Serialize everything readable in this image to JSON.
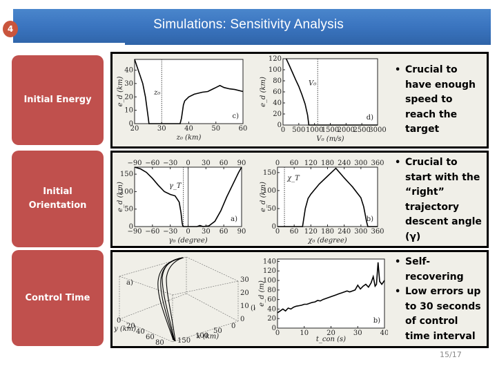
{
  "slide": {
    "section_number": "4",
    "title": "Simulations: Sensitivity Analysis",
    "page": "15/17",
    "colors": {
      "header": "#3a74bf",
      "label_box": "#c0504d",
      "badge": "#c9553d",
      "panel_bg": "#f0efe8"
    }
  },
  "rows": [
    {
      "label": "Initial Energy",
      "bullets": [
        "Crucial to have enough speed to reach the target"
      ]
    },
    {
      "label": "Initial Orientation",
      "bullets": [
        "Crucial to start with the “right” trajectory descent angle (γ)"
      ]
    },
    {
      "label": "Control Time",
      "bullets": [
        "Self-recovering",
        "Low errors up to 30 seconds of control time interval"
      ]
    }
  ],
  "chart_data": [
    {
      "type": "line",
      "panel": "c)",
      "xlabel": "z₀ (km)",
      "ylabel": "e_d (km)",
      "xlim": [
        20,
        60
      ],
      "ylim": [
        0,
        48
      ],
      "xticks": [
        20,
        30,
        40,
        50,
        60
      ],
      "yticks": [
        0,
        10,
        20,
        30,
        40
      ],
      "marker_label": "z₀",
      "marker_x": 30,
      "x": [
        20,
        21,
        22,
        23,
        24,
        25,
        25.3,
        30,
        36,
        36.8,
        37.3,
        38,
        38.5,
        40,
        42,
        45,
        47,
        49,
        50,
        51.5,
        53,
        55,
        57,
        60
      ],
      "y": [
        48,
        42,
        36,
        30,
        20,
        5,
        0,
        0,
        0,
        0,
        4,
        14,
        17,
        20,
        22,
        23.5,
        24,
        26,
        27,
        28.5,
        27,
        26,
        25.5,
        24
      ]
    },
    {
      "type": "line",
      "panel": "d)",
      "xlabel": "V₀ (m/s)",
      "ylabel": "e_d (km)",
      "xlim": [
        0,
        3000
      ],
      "ylim": [
        0,
        120
      ],
      "xticks": [
        0,
        500,
        1000,
        1500,
        2000,
        2500,
        3000
      ],
      "yticks": [
        0,
        20,
        40,
        60,
        80,
        100,
        120
      ],
      "marker_label": "V₀",
      "marker_x": 1100,
      "x": [
        100,
        200,
        300,
        400,
        500,
        600,
        700,
        780,
        820,
        3000
      ],
      "y": [
        120,
        108,
        95,
        82,
        70,
        55,
        38,
        18,
        0,
        0
      ]
    },
    {
      "type": "line",
      "panel": "a)",
      "xlabel": "γ₀ (degree)",
      "ylabel": "e_d (km)",
      "xlim": [
        -90,
        90
      ],
      "ylim": [
        0,
        170
      ],
      "xticks": [
        -90,
        -60,
        -30,
        0,
        30,
        60,
        90
      ],
      "yticks": [
        0,
        50,
        100,
        150
      ],
      "top_xticks": [
        -90,
        -60,
        -30,
        0,
        30,
        60,
        90
      ],
      "marker_label": "γ_T",
      "marker_x": -8,
      "x": [
        -90,
        -80,
        -70,
        -60,
        -50,
        -40,
        -30,
        -22,
        -15,
        -12,
        -10,
        -9,
        -8,
        0,
        15,
        20,
        25,
        35,
        45,
        55,
        65,
        75,
        85,
        90
      ],
      "y": [
        170,
        165,
        155,
        138,
        118,
        100,
        92,
        88,
        70,
        40,
        10,
        2,
        0,
        0,
        0,
        3,
        0,
        2,
        15,
        45,
        85,
        120,
        155,
        170
      ]
    },
    {
      "type": "line",
      "panel": "b)",
      "xlabel": "χ₀ (degree)",
      "ylabel": "e_d (km)",
      "xlim": [
        0,
        360
      ],
      "ylim": [
        0,
        165
      ],
      "xticks": [
        0,
        60,
        120,
        180,
        240,
        300,
        360
      ],
      "yticks": [
        0,
        50,
        100,
        150
      ],
      "top_xticks": [
        0,
        60,
        120,
        180,
        240,
        300,
        360
      ],
      "marker_label": "χ_T",
      "marker_x": 25,
      "x": [
        0,
        90,
        100,
        110,
        120,
        150,
        180,
        210,
        240,
        270,
        300,
        310,
        320,
        325,
        360
      ],
      "y": [
        0,
        0,
        50,
        78,
        90,
        118,
        140,
        162,
        135,
        110,
        80,
        55,
        15,
        0,
        0
      ]
    },
    {
      "type": "line",
      "panel": "a) 3D trajectories",
      "xlabel": "x (km)",
      "ylabel": "y (km)",
      "zlabel": "(km)",
      "x_ticks": [
        0,
        50,
        100,
        150
      ],
      "y_ticks": [
        0,
        20,
        40,
        60,
        80
      ],
      "z_ticks": [
        0,
        10,
        20,
        30
      ]
    },
    {
      "type": "line",
      "panel": "b)",
      "xlabel": "t_con (s)",
      "ylabel": "e_d (m)",
      "xlim": [
        0,
        40
      ],
      "ylim": [
        0,
        145
      ],
      "xticks": [
        0,
        10,
        20,
        30,
        40
      ],
      "yticks": [
        0,
        20,
        40,
        60,
        80,
        100,
        120,
        140
      ],
      "x": [
        0,
        1,
        2,
        3,
        4,
        5,
        6,
        7,
        8,
        9,
        10,
        11,
        12,
        13,
        14,
        15,
        16,
        17,
        18,
        19,
        20,
        21,
        22,
        23,
        24,
        25,
        26,
        27,
        28,
        29,
        30,
        31,
        32,
        33,
        34,
        35,
        35.8,
        36.5,
        37,
        37.6,
        38.2,
        39,
        40
      ],
      "y": [
        32,
        36,
        40,
        36,
        42,
        40,
        44,
        46,
        47,
        48,
        50,
        50,
        52,
        54,
        55,
        58,
        57,
        60,
        62,
        64,
        66,
        68,
        70,
        72,
        74,
        76,
        78,
        76,
        78,
        80,
        90,
        82,
        88,
        92,
        86,
        95,
        108,
        88,
        92,
        138,
        98,
        92,
        100
      ]
    }
  ]
}
